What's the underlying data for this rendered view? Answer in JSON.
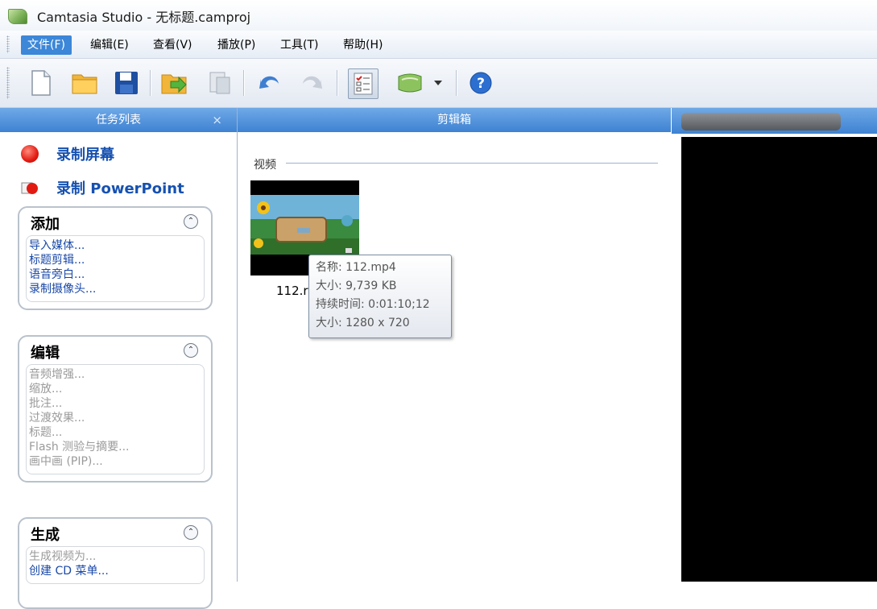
{
  "window": {
    "title": "Camtasia Studio - 无标题.camproj"
  },
  "menu": {
    "items": [
      "文件(F)",
      "编辑(E)",
      "查看(V)",
      "播放(P)",
      "工具(T)",
      "帮助(H)"
    ],
    "active_index": 0
  },
  "toolbar": {
    "buttons": [
      "new-project-icon",
      "open-folder-icon",
      "save-icon",
      "import-media-icon",
      "produce-icon",
      "undo-icon",
      "redo-icon",
      "task-list-icon",
      "library-icon",
      "dropdown-arrow-icon",
      "help-icon"
    ]
  },
  "task_panel": {
    "title": "任务列表",
    "close": "×",
    "record_screen": "录制屏幕",
    "record_ppt": "录制 PowerPoint",
    "groups": [
      {
        "title": "添加",
        "items": [
          {
            "label": "导入媒体...",
            "enabled": true
          },
          {
            "label": "标题剪辑...",
            "enabled": true
          },
          {
            "label": "语音旁白...",
            "enabled": true
          },
          {
            "label": "录制摄像头...",
            "enabled": true
          }
        ]
      },
      {
        "title": "编辑",
        "items": [
          {
            "label": "音频增强...",
            "enabled": false
          },
          {
            "label": "缩放...",
            "enabled": false
          },
          {
            "label": "批注...",
            "enabled": false
          },
          {
            "label": "过渡效果...",
            "enabled": false
          },
          {
            "label": "标题...",
            "enabled": false
          },
          {
            "label": "Flash 测验与摘要...",
            "enabled": false
          },
          {
            "label": "画中画 (PIP)...",
            "enabled": false
          }
        ]
      },
      {
        "title": "生成",
        "items": [
          {
            "label": "生成视频为...",
            "enabled": false
          },
          {
            "label": "创建 CD 菜单...",
            "enabled": true
          }
        ]
      }
    ]
  },
  "clip_bin": {
    "title": "剪辑箱",
    "section": "视频",
    "clip_name": "112.r",
    "tooltip": {
      "name": "名称: 112.mp4",
      "size": "大小: 9,739 KB",
      "duration": "持续时间: 0:01:10;12",
      "dimensions": "大小: 1280 x 720"
    }
  }
}
